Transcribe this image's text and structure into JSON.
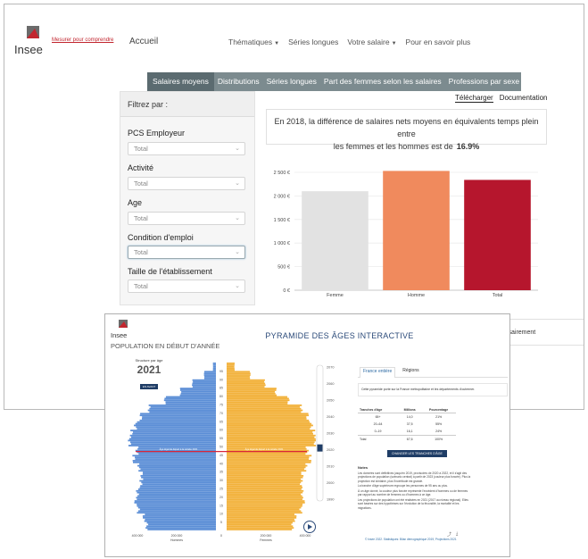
{
  "colors": {
    "brand_red": "#c2262f",
    "tab_bar": "#7c8b8f",
    "bar_femme": "#e2e2e2",
    "bar_homme": "#f08a5d",
    "bar_total": "#b6162d",
    "pyr_hommes": "#5b8ed6",
    "pyr_femmes": "#f2b13a",
    "navy": "#1f3d66"
  },
  "back_window": {
    "logo": {
      "word": "Insee",
      "tagline": "Mesurer pour comprendre",
      "icon": "insee-logo-icon"
    },
    "nav": {
      "home": "Accueil",
      "items": [
        {
          "label": "Thématiques",
          "dropdown": true
        },
        {
          "label": "Séries longues",
          "dropdown": false
        },
        {
          "label": "Votre salaire",
          "dropdown": true
        },
        {
          "label": "Pour en savoir plus",
          "dropdown": false
        }
      ]
    },
    "tabs": [
      "Salaires moyens",
      "Distributions",
      "Séries longues",
      "Part des femmes selon les salaires",
      "Professions par sexe"
    ],
    "active_tab": 0,
    "filters": {
      "title": "Filtrez par :",
      "items": [
        {
          "label": "PCS Employeur",
          "value": "Total"
        },
        {
          "label": "Activité",
          "value": "Total"
        },
        {
          "label": "Age",
          "value": "Total"
        },
        {
          "label": "Condition d'emploi",
          "value": "Total"
        },
        {
          "label": "Taille de l'établissement",
          "value": "Total"
        }
      ]
    },
    "links": {
      "download": "Télécharger",
      "documentation": "Documentation"
    },
    "summary": {
      "line1": "En 2018, la différence de salaires nets moyens en équivalents temps plein entre",
      "line2": "les femmes et les hommes est de",
      "value": "16.9%"
    },
    "side_box_text": "ssairement"
  },
  "chart_data": [
    {
      "type": "bar",
      "categories": [
        "Femme",
        "Homme",
        "Total"
      ],
      "values": [
        2100,
        2530,
        2340
      ],
      "ylim": [
        0,
        2500
      ],
      "yticks": [
        0,
        500,
        1000,
        1500,
        2000,
        2500
      ],
      "ytick_labels": [
        "0 €",
        "500 €",
        "1 000 €",
        "1 500 €",
        "2 000 €",
        "2 500 €"
      ],
      "xlabel": "",
      "ylabel": "",
      "grid": true
    },
    {
      "type": "bar",
      "orientation": "horizontal",
      "year": "2021",
      "ages": [
        0,
        5,
        10,
        15,
        20,
        25,
        30,
        35,
        40,
        45,
        50,
        55,
        60,
        65,
        70,
        75,
        80,
        85,
        90,
        95
      ],
      "series": [
        {
          "name": "Hommes",
          "values": [
            352000,
            368000,
            395000,
            410000,
            400000,
            382000,
            378000,
            392000,
            418000,
            402000,
            440000,
            430000,
            410000,
            382000,
            340000,
            260000,
            180000,
            120000,
            60000,
            15000
          ]
        },
        {
          "name": "Femmes",
          "values": [
            336000,
            351000,
            378000,
            393000,
            385000,
            380000,
            385000,
            403000,
            425000,
            410000,
            452000,
            445000,
            432000,
            412000,
            380000,
            315000,
            250000,
            195000,
            120000,
            40000
          ]
        }
      ],
      "xlim": [
        -400000,
        400000
      ],
      "xtick_labels": [
        "400 000",
        "200 000",
        "0",
        "200 000",
        "400 000"
      ],
      "yticks": [
        5,
        10,
        15,
        20,
        25,
        30,
        35,
        40,
        45,
        50,
        55,
        60,
        65,
        70,
        75,
        80,
        85,
        90,
        95
      ],
      "xlabel_left": "Hommes",
      "xlabel_right": "Femmes",
      "retirement_age_label_left": "Âge légal de départ à la retraite 2021",
      "retirement_age_label_right": "Âge légal de départ à la retraite 2021",
      "retirement_age": 47,
      "timeline_ticks": [
        "2070",
        "2060",
        "2050",
        "2040",
        "2030",
        "2020",
        "2010",
        "2000",
        "1990"
      ],
      "timeline_ticks_position_years": [
        2070,
        2060,
        2050,
        2040,
        2030,
        2020,
        2010,
        2000,
        1990
      ],
      "timeline_selected": 2021
    }
  ],
  "front_window": {
    "logo_word": "Insee",
    "title": "PYRAMIDE DES ÂGES INTERACTIVE",
    "subtitle": "POPULATION EN DÉBUT D'ANNÉE",
    "structure_label": "Structure par âge",
    "year": "2021",
    "year_button": "EN AVANT",
    "tabs": [
      "France entière",
      "Régions"
    ],
    "note": "Cette pyramide porte sur la France métropolitaine et les départements d'outremer.",
    "table": {
      "headers": [
        "Tranches d'âge",
        "Millions",
        "Pourcentage"
      ],
      "rows": [
        [
          "65+",
          "14,0",
          "21%"
        ],
        [
          "20–64",
          "37,5",
          "55%"
        ],
        [
          "0–19",
          "16,1",
          "24%"
        ],
        [
          "Total",
          "67,6",
          "100%"
        ]
      ]
    },
    "button": "CHANGER LES TRANCHES D'ÂGE",
    "notes_title": "Notes",
    "notes": [
      "Les données sont définitives jusqu'en 2019, provisoires de 2020 à 2022, et il s'agit des projections de population (scénario central) à partir de 2023 (couleur plus foncée). Plus la projection est lointaine, plus l'incertitude est grande.",
      "La tranche d'âge supérieure regroupe les personnes de 95 ans ou plus.",
      "À un âge donné, la couleur plus foncée représente l'excédent d'hommes ou de femmes par rapport au nombre de femmes ou d'hommes à ce âge.",
      "Les projections de population ont été réalisées en 2021 (2017 au niveau régional). Elles sont basées sur des hypothèses sur l'évolution de la fécondité, la mortalité et les migrations."
    ],
    "credit": "© Insee 2022. Statistiques: Bilan démographique 2019, Projections 2021"
  }
}
